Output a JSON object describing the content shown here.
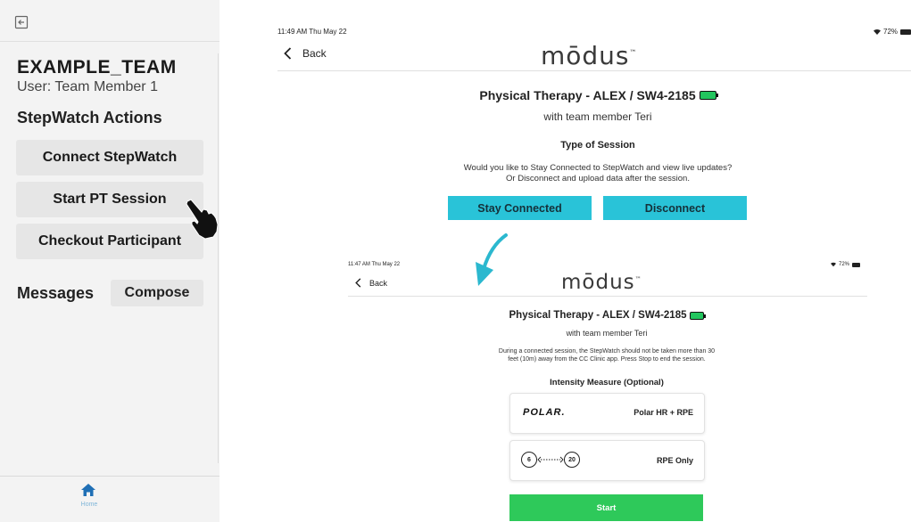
{
  "sidebar": {
    "team_name": "EXAMPLE_TEAM",
    "user": "User: Team Member 1",
    "actions_heading": "StepWatch Actions",
    "buttons": [
      "Connect StepWatch",
      "Start PT Session",
      "Checkout Participant"
    ],
    "messages_label": "Messages",
    "compose_label": "Compose",
    "tab_home": "Home"
  },
  "top_screen": {
    "status_time": "11:49 AM  Thu May 22",
    "status_battery": "72%",
    "back_label": "Back",
    "logo": "mōdus",
    "logo_mark": "™",
    "title": "Physical Therapy - ALEX / SW4-2185",
    "subtitle": "with team member Teri",
    "section_heading": "Type of Session",
    "prompt_line1": "Would you like to Stay Connected to StepWatch and view live updates?",
    "prompt_line2": "Or Disconnect and upload data after the session.",
    "stay_connected": "Stay Connected",
    "disconnect": "Disconnect"
  },
  "bottom_screen": {
    "status_time": "11:47 AM  Thu May 22",
    "status_battery": "72%",
    "back_label": "Back",
    "logo": "mōdus",
    "logo_mark": "™",
    "title": "Physical Therapy - ALEX / SW4-2185",
    "subtitle": "with team member Teri",
    "info_line1": "During a connected session, the StepWatch should not be taken more than 30",
    "info_line2": "feet (10m) away from the CC Clinic app. Press Stop to end the session.",
    "intensity_heading": "Intensity Measure (Optional)",
    "polar_logo": "POLAR.",
    "polar_option": "Polar HR + RPE",
    "rpe_low": "6",
    "rpe_high": "20",
    "rpe_option": "RPE Only",
    "start": "Start"
  },
  "colors": {
    "teal": "#29c3d8",
    "green": "#2ec95a",
    "arrow": "#2bb8cf",
    "home_tab": "#1f6fb5"
  }
}
